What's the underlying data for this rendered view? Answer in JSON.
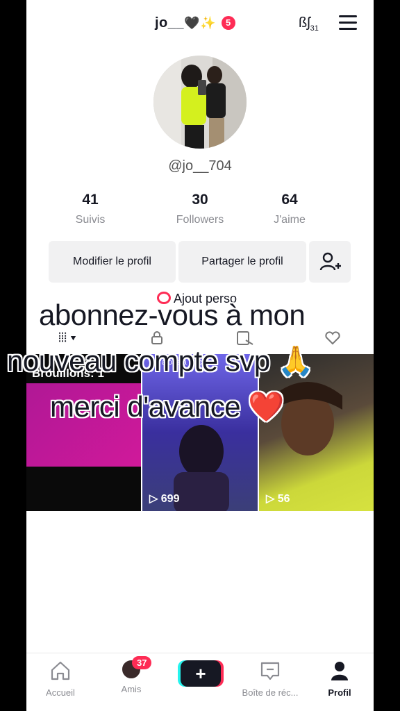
{
  "header": {
    "username": "jo__",
    "username_emojis": "🖤✨",
    "notification_count": "5",
    "top_icon_text": "ßʃ",
    "top_icon_sub": "31"
  },
  "profile": {
    "handle": "@jo__704",
    "stats": [
      {
        "value": "41",
        "label": "Suivis"
      },
      {
        "value": "30",
        "label": "Followers"
      },
      {
        "value": "64",
        "label": "J'aime"
      }
    ],
    "edit_button": "Modifier le profil",
    "share_button": "Partager le profil",
    "add_bio": "Ajout perso"
  },
  "tabs": {
    "grid_icon": "⦙⦙⦙",
    "dropdown": "▾"
  },
  "videos": [
    {
      "label": "Brouillons: 1"
    },
    {
      "caption": "y'a pas à discuter",
      "views": "699"
    },
    {
      "views": "56"
    }
  ],
  "overlay_text": {
    "line1": "abonnez-vous à mon",
    "line2": "nouveau compte svp 🙏",
    "line3": "merci d'avance ❤️"
  },
  "bottom_nav": {
    "home": "Accueil",
    "friends": "Amis",
    "friends_badge": "37",
    "create": "+",
    "inbox": "Boîte de réc...",
    "profile": "Profil"
  },
  "colors": {
    "accent": "#fe2c55",
    "text": "#161823",
    "muted": "#8a8b91",
    "button_bg": "#f1f1f2"
  }
}
